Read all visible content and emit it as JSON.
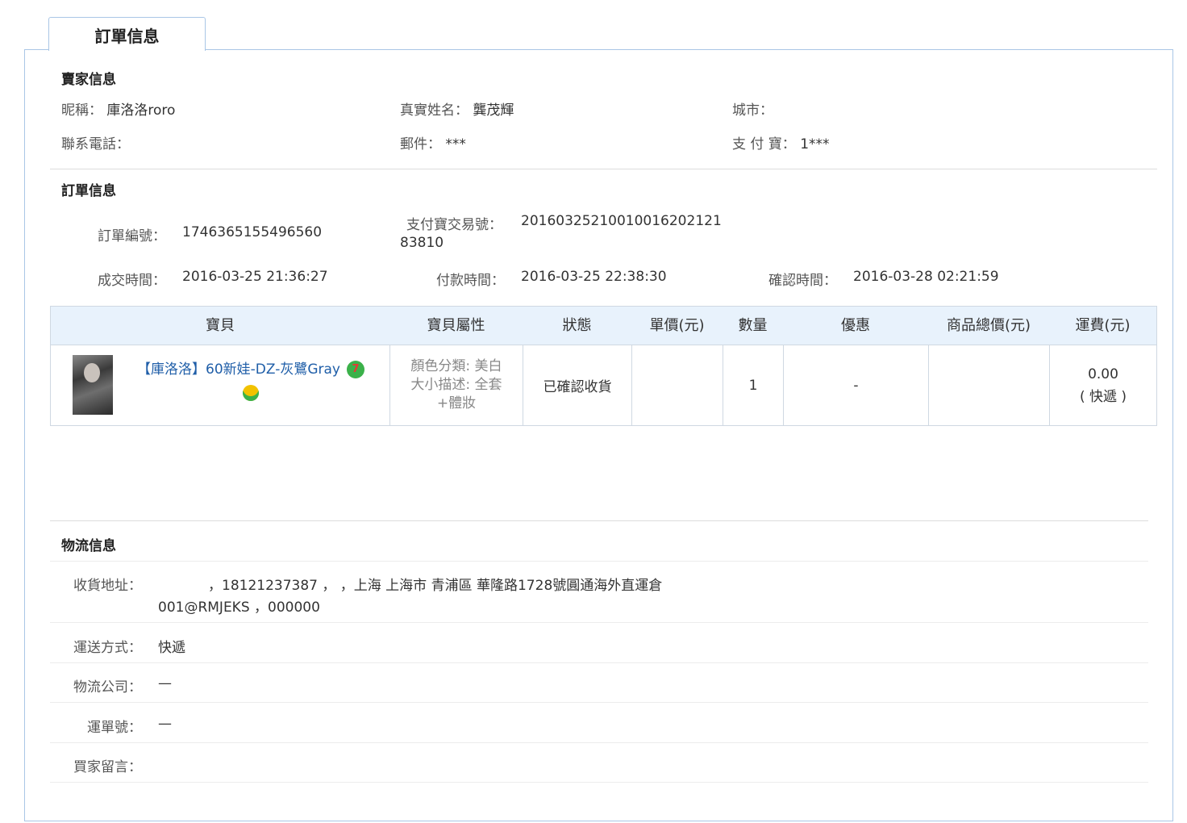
{
  "tab": {
    "label": "訂單信息"
  },
  "seller": {
    "title": "賣家信息",
    "nickname_label": "昵稱：",
    "nickname": "庫洛洛roro",
    "realname_label": "真實姓名：",
    "realname": "龔茂輝",
    "city_label": "城市：",
    "city": "",
    "phone_label": "聯系電話：",
    "phone": "",
    "email_label": "郵件：",
    "email": "***",
    "alipay_label": "支 付 寶：",
    "alipay": "1***"
  },
  "order": {
    "title": "訂單信息",
    "order_no_label": "訂單編號：",
    "order_no": "1746365155496560",
    "alipay_trade_label": "支付寶交易號：",
    "alipay_trade_line1": "2016032521001001620212​1",
    "alipay_trade_line2": "83810",
    "deal_time_label": "成交時間：",
    "deal_time": "2016-03-25 21:36:27",
    "pay_time_label": "付款時間：",
    "pay_time": "2016-03-25 22:38:30",
    "confirm_time_label": "確認時間：",
    "confirm_time": "2016-03-28 02:21:59"
  },
  "table": {
    "headers": [
      "寶貝",
      "寶貝屬性",
      "狀態",
      "單價(元)",
      "數量",
      "優惠",
      "商品總價(元)",
      "運費(元)"
    ],
    "row": {
      "product_name": "【庫洛洛】60新娃-DZ-灰鷺Gray",
      "attr_line1": "顏色分類: 美白",
      "attr_line2": "大小描述: 全套",
      "attr_line3": "+體妝",
      "status": "已確認收貨",
      "unit_price": "",
      "quantity": "1",
      "discount": "-",
      "total": "",
      "shipping_fee": "0.00",
      "shipping_method": "( 快遞 )"
    }
  },
  "logistics": {
    "title": "物流信息",
    "address_label": "收貨地址：",
    "address_line1": "，18121237387 ， ，上海 上海市 青浦區 華隆路1728號圓通海外直運倉",
    "address_line2": "001@RMJEKS ，000000",
    "method_label": "運送方式：",
    "method": "快遞",
    "company_label": "物流公司：",
    "company": "—",
    "waybill_label": "運單號：",
    "waybill": "—",
    "message_label": "買家留言：",
    "message": ""
  }
}
